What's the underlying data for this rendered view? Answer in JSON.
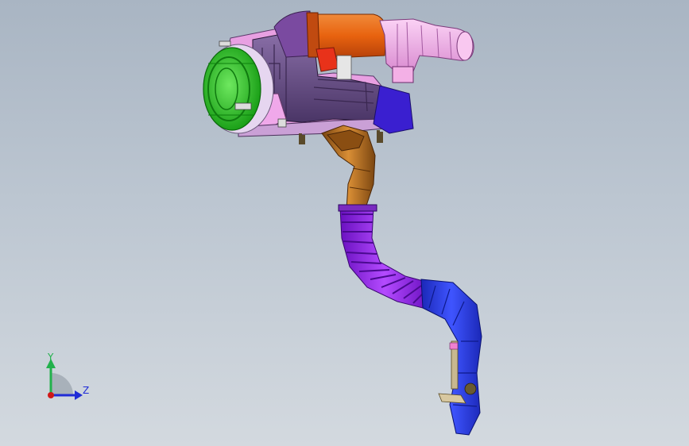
{
  "viewport": {
    "background_top": "#a9b5c3",
    "background_bottom": "#d3d9df"
  },
  "triad": {
    "y_label": "Y",
    "z_label": "Z",
    "y_color": "#22b14c",
    "z_color": "#1f2bd6",
    "x_color": "#d01818"
  },
  "parts": [
    {
      "name": "air-filter-cover",
      "color": "#22c41c"
    },
    {
      "name": "airbox-body",
      "color": "#6b4d8c"
    },
    {
      "name": "airbox-trim",
      "color": "#e58be0"
    },
    {
      "name": "intake-duct",
      "color": "#e8630f"
    },
    {
      "name": "resonator",
      "color": "#f2a8e8"
    },
    {
      "name": "outlet-connector",
      "color": "#3a1fd0"
    },
    {
      "name": "elbow-duct",
      "color": "#b46a1c"
    },
    {
      "name": "corrugated-hose",
      "color": "#9b2ff0"
    },
    {
      "name": "lower-intake-duct",
      "color": "#2a3fe0"
    }
  ]
}
